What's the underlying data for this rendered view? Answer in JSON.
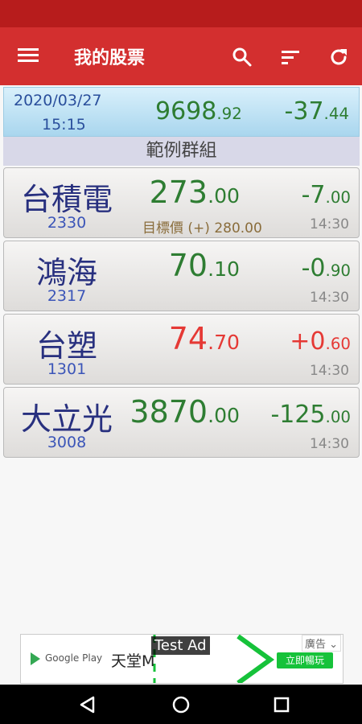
{
  "app_bar": {
    "title": "我的股票",
    "menu_icon": "hamburger-menu-icon",
    "actions": [
      "search-icon",
      "sort-icon",
      "refresh-icon"
    ]
  },
  "index": {
    "date": "2020/03/27",
    "time": "15:15",
    "value_int": "9698",
    "value_dec": ".92",
    "change_int": "-37",
    "change_dec": ".44"
  },
  "group": {
    "name": "範例群組"
  },
  "stocks": [
    {
      "name": "台積電",
      "code": "2330",
      "price_int": "273",
      "price_dec": ".00",
      "change_int": "-7",
      "change_dec": ".00",
      "target": "目標價 (+) 280.00",
      "time": "14:30",
      "trend": "down"
    },
    {
      "name": "鴻海",
      "code": "2317",
      "price_int": "70",
      "price_dec": ".10",
      "change_int": "-0",
      "change_dec": ".90",
      "target": "",
      "time": "14:30",
      "trend": "down"
    },
    {
      "name": "台塑",
      "code": "1301",
      "price_int": "74",
      "price_dec": ".70",
      "change_int": "+0",
      "change_dec": ".60",
      "target": "",
      "time": "14:30",
      "trend": "up"
    },
    {
      "name": "大立光",
      "code": "3008",
      "price_int": "3870",
      "price_dec": ".00",
      "change_int": "-125",
      "change_dec": ".00",
      "target": "",
      "time": "14:30",
      "trend": "down"
    }
  ],
  "ad": {
    "store": "Google Play",
    "app_name": "天堂M",
    "test_label": "Test Ad",
    "badge": "廣告",
    "install_label": "立即暢玩"
  },
  "colors": {
    "primary": "#d32f2f",
    "status_bar": "#b71c1c",
    "up": "#e53935",
    "down": "#2e7d32",
    "name": "#28307f",
    "code": "#3b55b8"
  }
}
